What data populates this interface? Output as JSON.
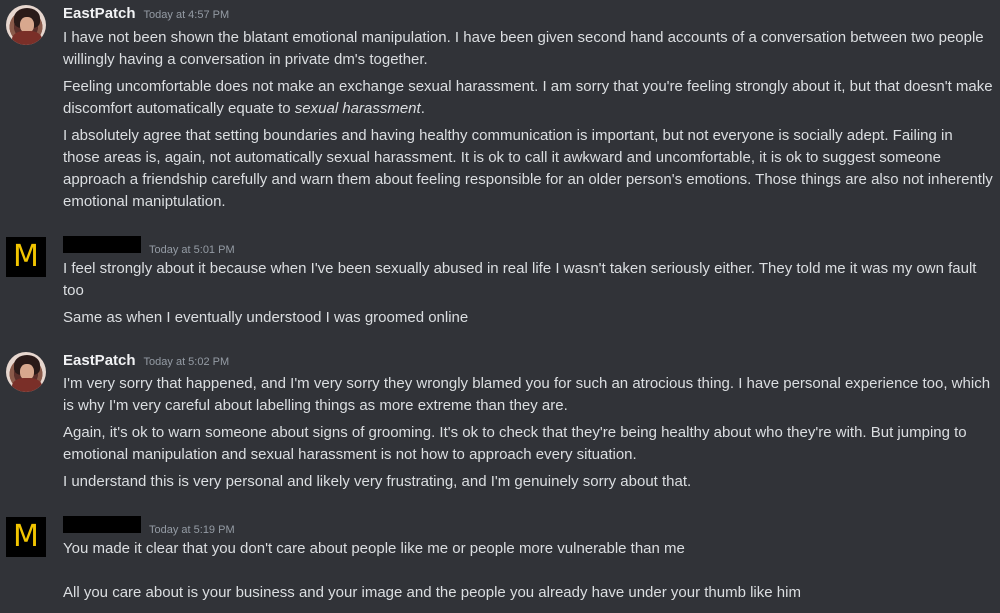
{
  "messages": [
    {
      "username": "EastPatch",
      "timestamp": "Today at 4:57 PM",
      "paragraphs": [
        "I have not been shown the blatant emotional manipulation. I have been given second hand accounts of a conversation between two people willingly having a conversation in private dm's together.",
        "Feeling uncomfortable does not make an exchange sexual harassment. I am sorry that you're feeling strongly about it, but that doesn't make discomfort automatically equate to",
        "sexual harassment",
        "I absolutely agree that setting boundaries and having healthy communication is important, but not everyone is socially adept. Failing in those areas is, again, not automatically sexual harassment. It is ok to call it awkward and uncomfortable, it is ok to suggest someone approach a friendship carefully and warn them about feeling responsible for an older person's emotions. Those things are also not inherently emotional maniptulation."
      ]
    },
    {
      "avatar_letter": "M",
      "timestamp": "Today at 5:01 PM",
      "paragraphs": [
        "I feel strongly about it because when I've been sexually abused in real life I wasn't taken seriously either. They told me it was my own fault too",
        "Same as when I eventually understood I was groomed online"
      ]
    },
    {
      "username": "EastPatch",
      "timestamp": "Today at 5:02 PM",
      "paragraphs": [
        "I'm very sorry that happened, and I'm very sorry they wrongly blamed you for such an atrocious thing. I have personal experience too, which is why I'm very careful about labelling things as more extreme than they are.",
        "Again, it's ok to warn someone about signs of grooming. It's ok to check that they're being healthy about who they're with. But jumping to emotional manipulation and sexual harassment is not how to approach every situation.",
        "I understand this is very personal and likely very frustrating, and I'm genuinely sorry about that."
      ]
    },
    {
      "avatar_letter": "M",
      "timestamp": "Today at 5:19 PM",
      "paragraphs": [
        "You made it clear that you don't care about people like me  or people more vulnerable than me",
        "All you care about is your business and your image and the people you already have under your thumb like him"
      ]
    }
  ],
  "colors": {
    "background": "#313338",
    "text": "#dbdee1",
    "username": "#f2f3f5",
    "timestamp": "#949ba4",
    "m_avatar_letter": "#f2c500",
    "m_avatar_bg": "#000000"
  }
}
